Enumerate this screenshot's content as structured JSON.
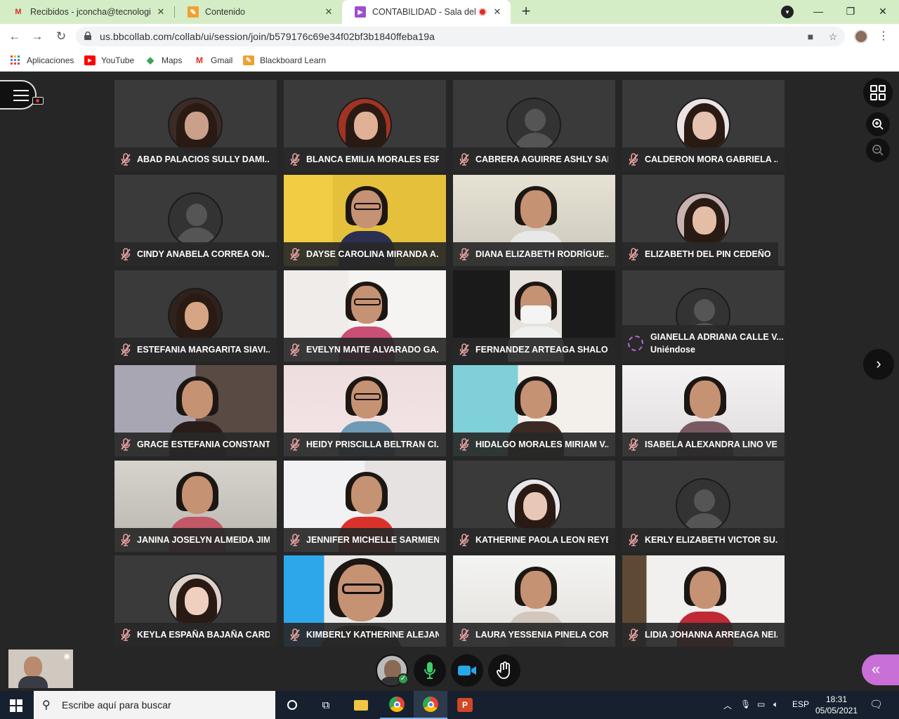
{
  "browser": {
    "tabs": [
      {
        "title": "Recibidos - jconcha@tecnologico",
        "icon": "gmail-icon"
      },
      {
        "title": "Contenido",
        "icon": "blackboard-icon"
      },
      {
        "title": "CONTABILIDAD - Sala del cu",
        "icon": "collaborate-icon",
        "active": true
      }
    ],
    "url": "us.bbcollab.com/collab/ui/session/join/b579176c69e34f02bf3b1840ffeba19a",
    "bookmarks": [
      {
        "label": "Aplicaciones",
        "icon": "apps-grid-icon"
      },
      {
        "label": "YouTube",
        "icon": "youtube-icon"
      },
      {
        "label": "Maps",
        "icon": "maps-icon"
      },
      {
        "label": "Gmail",
        "icon": "gmail-icon"
      },
      {
        "label": "Blackboard Learn",
        "icon": "blackboard-icon"
      }
    ]
  },
  "participants": [
    {
      "name": "ABAD PALACIOS SULLY DAMI...",
      "kind": "photo"
    },
    {
      "name": "BLANCA EMILIA MORALES ESP...",
      "kind": "photo"
    },
    {
      "name": "CABRERA AGUIRRE ASHLY SAL...",
      "kind": "generic"
    },
    {
      "name": "CALDERON MORA GABRIELA ...",
      "kind": "photo"
    },
    {
      "name": "CINDY ANABELA CORREA ON...",
      "kind": "generic"
    },
    {
      "name": "DAYSE CAROLINA MIRANDA A...",
      "kind": "video"
    },
    {
      "name": "DIANA ELIZABETH RODRÍGUE...",
      "kind": "video"
    },
    {
      "name": "ELIZABETH DEL PIN CEDEÑO",
      "kind": "photo"
    },
    {
      "name": "ESTEFANIA MARGARITA SIAVI...",
      "kind": "photo"
    },
    {
      "name": "EVELYN MAITE ALVARADO GA...",
      "kind": "video"
    },
    {
      "name": "FERNANDEZ ARTEAGA SHALO...",
      "kind": "video"
    },
    {
      "name": "GIANELLA ADRIANA CALLE V...",
      "kind": "joining",
      "status": "Uniéndose"
    },
    {
      "name": "GRACE ESTEFANIA CONSTANT...",
      "kind": "video"
    },
    {
      "name": "HEIDY PRISCILLA BELTRAN CI...",
      "kind": "video"
    },
    {
      "name": "HIDALGO MORALES MIRIAM V...",
      "kind": "video"
    },
    {
      "name": "ISABELA ALEXANDRA LINO VE...",
      "kind": "video"
    },
    {
      "name": "JANINA JOSELYN ALMEIDA JIM...",
      "kind": "video"
    },
    {
      "name": "JENNIFER MICHELLE SARMIEN...",
      "kind": "video"
    },
    {
      "name": "KATHERINE PAOLA LEON REYES",
      "kind": "photo"
    },
    {
      "name": "KERLY ELIZABETH VICTOR SU...",
      "kind": "generic"
    },
    {
      "name": "KEYLA ESPAÑA BAJAÑA CARD...",
      "kind": "photo"
    },
    {
      "name": "KIMBERLY KATHERINE ALEJAN...",
      "kind": "video"
    },
    {
      "name": "LAURA YESSENIA PINELA COR...",
      "kind": "video"
    },
    {
      "name": "LIDIA JOHANNA ARREAGA NEI...",
      "kind": "video"
    }
  ],
  "taskbar": {
    "search_placeholder": "Escribe aquí para buscar",
    "language": "ESP",
    "time": "18:31",
    "date": "05/05/2021"
  },
  "colors": {
    "tabbar": "#d4edc6",
    "stage": "#262626",
    "collab_accent": "#c86fd8",
    "mic_off": "#e8a0a0"
  }
}
